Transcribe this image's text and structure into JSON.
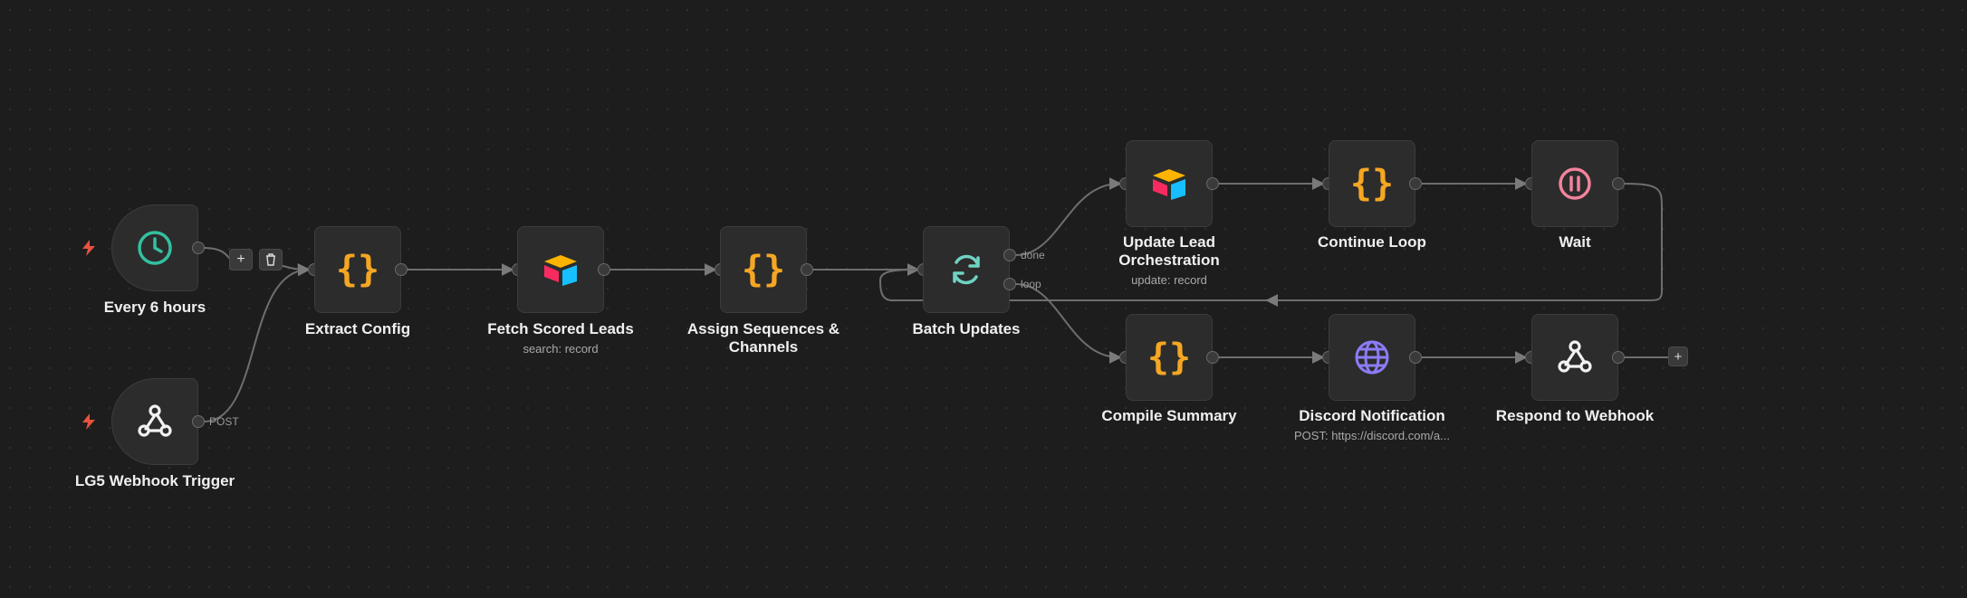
{
  "nodes": {
    "every6h": {
      "label": "Every 6 hours",
      "icon": "clock-icon",
      "color": "#34c0a0"
    },
    "webhook_trigger": {
      "label": "LG5 Webhook Trigger",
      "icon": "webhook-icon",
      "port_label": "POST"
    },
    "extract_config": {
      "label": "Extract Config",
      "icon": "code-braces-icon",
      "color": "#f5a623"
    },
    "fetch_leads": {
      "label": "Fetch Scored Leads",
      "sub": "search: record",
      "icon": "airtable-icon"
    },
    "assign_seq": {
      "label": "Assign Sequences & Channels",
      "icon": "code-braces-icon"
    },
    "batch_updates": {
      "label": "Batch Updates",
      "icon": "refresh-icon",
      "color": "#6fd3c3",
      "done_label": "done",
      "loop_label": "loop"
    },
    "update_lead": {
      "label": "Update Lead Orchestration",
      "sub": "update: record",
      "icon": "airtable-icon"
    },
    "continue_loop": {
      "label": "Continue Loop",
      "icon": "code-braces-icon"
    },
    "wait": {
      "label": "Wait",
      "icon": "pause-icon",
      "color": "#f2839b"
    },
    "compile_summary": {
      "label": "Compile Summary",
      "icon": "code-braces-icon"
    },
    "discord": {
      "label": "Discord Notification",
      "sub": "POST: https://discord.com/a...",
      "icon": "globe-icon",
      "color": "#8b7cf6"
    },
    "respond": {
      "label": "Respond to Webhook",
      "icon": "webhook-icon"
    }
  },
  "edge_controls": {
    "add": "+",
    "delete": "trash-icon",
    "end_add": "+"
  },
  "colors": {
    "trigger_bolt": "#e8533f",
    "edge": "#6e6e6e"
  }
}
